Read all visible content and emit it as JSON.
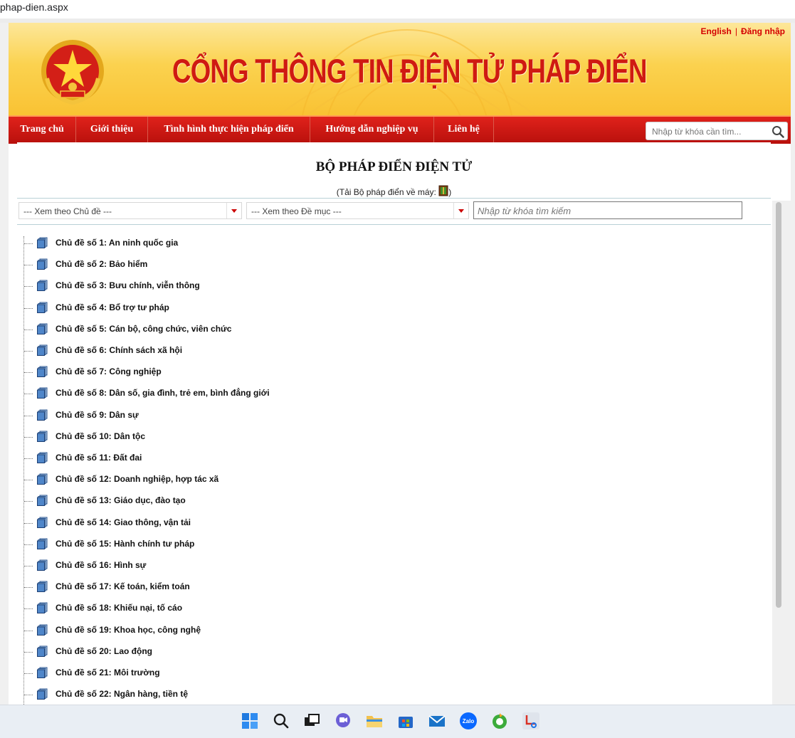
{
  "browser": {
    "url": "phap-dien.aspx"
  },
  "header": {
    "title": "CỔNG THÔNG TIN ĐIỆN TỬ PHÁP ĐIỂN",
    "links": {
      "english": "English",
      "login": "Đăng nhập"
    }
  },
  "nav": {
    "items": [
      {
        "label": "Trang chủ"
      },
      {
        "label": "Giới thiệu"
      },
      {
        "label": "Tình hình thực hiện pháp điển"
      },
      {
        "label": "Hướng dẫn nghiệp vụ"
      },
      {
        "label": "Liên hệ"
      }
    ],
    "search_placeholder": "Nhập từ khóa cần tìm..."
  },
  "main": {
    "heading": "BỘ PHÁP ĐIỂN ĐIỆN TỬ",
    "download_prefix": "(Tải Bộ pháp điển về máy: ",
    "download_suffix": ")",
    "filter": {
      "topic_select": "--- Xem theo Chủ đề ---",
      "section_select": "--- Xem theo Đề mục ---",
      "keyword_placeholder": "Nhập từ khóa tìm kiếm"
    },
    "topics": [
      "Chủ đề số 1: An ninh quốc gia",
      "Chủ đề số 2: Bảo hiểm",
      "Chủ đề số 3: Bưu chính, viễn thông",
      "Chủ đề số 4: Bổ trợ tư pháp",
      "Chủ đề số 5: Cán bộ, công chức, viên chức",
      "Chủ đề số 6: Chính sách xã hội",
      "Chủ đề số 7: Công nghiệp",
      "Chủ đề số 8: Dân số, gia đình, trẻ em, bình đẳng giới",
      "Chủ đề số 9: Dân sự",
      "Chủ đề số 10: Dân tộc",
      "Chủ đề số 11: Đất đai",
      "Chủ đề số 12: Doanh nghiệp, hợp tác xã",
      "Chủ đề số 13: Giáo dục, đào tạo",
      "Chủ đề số 14: Giao thông, vận tải",
      "Chủ đề số 15: Hành chính tư pháp",
      "Chủ đề số 16: Hình sự",
      "Chủ đề số 17: Kế toán, kiểm toán",
      "Chủ đề số 18: Khiếu nại, tố cáo",
      "Chủ đề số 19: Khoa học, công nghệ",
      "Chủ đề số 20: Lao động",
      "Chủ đề số 21: Môi trường",
      "Chủ đề số 22: Ngân hàng, tiền tệ"
    ]
  },
  "colors": {
    "brand_red": "#cf1a12",
    "nav_red": "#c8140f",
    "header_yellow": "#fbd24f"
  },
  "taskbar": {
    "icons": [
      "windows-start-icon",
      "search-icon",
      "task-view-icon",
      "chat-icon",
      "file-explorer-icon",
      "store-icon",
      "mail-icon",
      "zalo-icon",
      "coccoc-browser-icon",
      "snipping-tool-icon"
    ]
  }
}
